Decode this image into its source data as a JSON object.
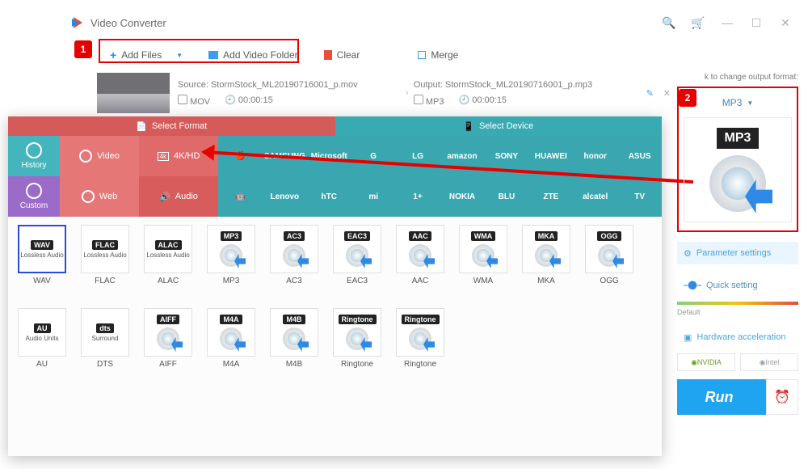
{
  "titlebar": {
    "title": "Video Converter"
  },
  "toolbar": {
    "add_files": "Add Files",
    "add_folder": "Add Video Folder",
    "clear": "Clear",
    "merge": "Merge"
  },
  "markers": {
    "one": "1",
    "two": "2"
  },
  "file": {
    "source_lbl": "Source: StormStock_ML20190716001_p.mov",
    "src_fmt": "MOV",
    "src_dur": "00:00:15",
    "output_lbl": "Output: StormStock_ML20190716001_p.mp3",
    "out_fmt": "MP3",
    "out_dur": "00:00:15"
  },
  "panel": {
    "tab_format": "Select Format",
    "tab_device": "Select Device",
    "sidebar": {
      "history": "History",
      "custom": "Custom"
    },
    "cats": {
      "video": "Video",
      "fourk": "4K/HD",
      "web": "Web",
      "audio": "Audio"
    },
    "brands_row1": [
      "",
      "SAMSUNG",
      "Microsoft",
      "G",
      "LG",
      "amazon",
      "SONY",
      "HUAWEI",
      "honor",
      "ASUS"
    ],
    "brands_row2": [
      "",
      "Lenovo",
      "hTC",
      "mi",
      "1+",
      "NOKIA",
      "BLU",
      "ZTE",
      "alcatel",
      "TV"
    ],
    "formats_row1": [
      {
        "badge": "WAV",
        "sub": "Lossless Audio",
        "label": "WAV",
        "sel": true
      },
      {
        "badge": "FLAC",
        "sub": "Lossless Audio",
        "label": "FLAC"
      },
      {
        "badge": "ALAC",
        "sub": "Lossless Audio",
        "label": "ALAC"
      },
      {
        "badge": "MP3",
        "disc": true,
        "label": "MP3"
      },
      {
        "badge": "AC3",
        "disc": true,
        "label": "AC3"
      },
      {
        "badge": "EAC3",
        "disc": true,
        "label": "EAC3"
      },
      {
        "badge": "AAC",
        "disc": true,
        "label": "AAC"
      },
      {
        "badge": "WMA",
        "disc": true,
        "label": "WMA"
      },
      {
        "badge": "MKA",
        "disc": true,
        "label": "MKA"
      },
      {
        "badge": "OGG",
        "disc": true,
        "label": "OGG"
      }
    ],
    "formats_row2": [
      {
        "badge": "AU",
        "sub": "Audio Units",
        "label": "AU"
      },
      {
        "badge": "dts",
        "sub": "Surround",
        "label": "DTS"
      },
      {
        "badge": "AIFF",
        "disc": true,
        "label": "AIFF"
      },
      {
        "badge": "M4A",
        "disc": true,
        "label": "M4A"
      },
      {
        "badge": "M4B",
        "disc": true,
        "label": "M4B"
      },
      {
        "badge": "Ringtone",
        "disc": true,
        "label": "Ringtone"
      },
      {
        "badge": "Ringtone",
        "disc": true,
        "label": "Ringtone"
      }
    ]
  },
  "right": {
    "hint": "k to change output format:",
    "fmt": "MP3",
    "mp3_badge": "MP3",
    "params": "Parameter settings",
    "quick": "Quick setting",
    "default": "Default",
    "hw": "Hardware acceleration",
    "nvidia": "NVIDIA",
    "intel": "Intel",
    "run": "Run"
  }
}
